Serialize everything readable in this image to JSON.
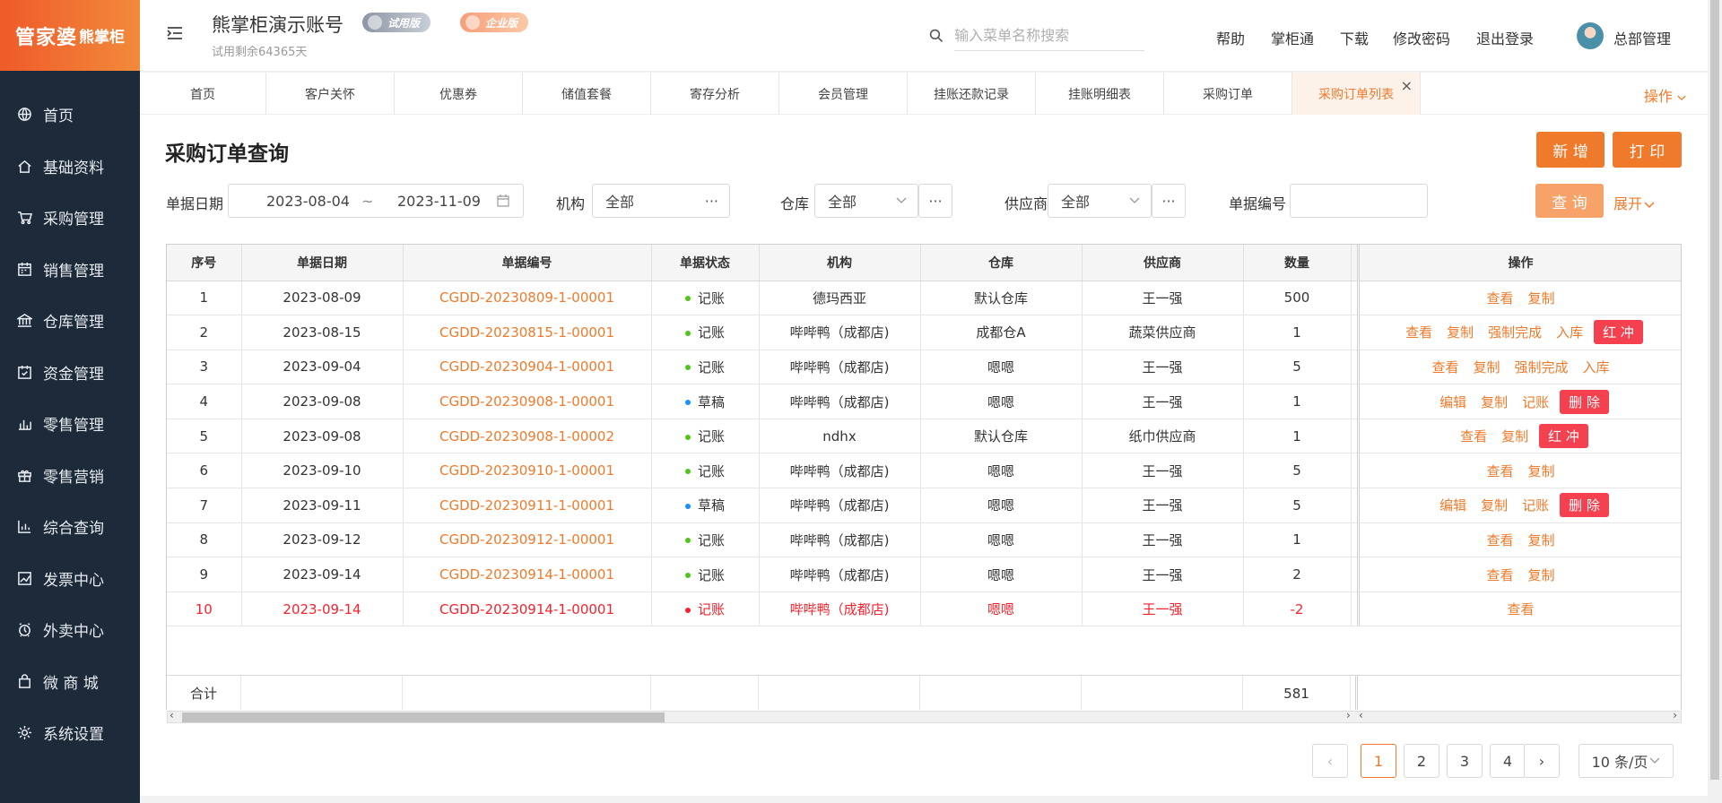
{
  "logo": {
    "part1": "管家婆",
    "part2": "熊掌柜"
  },
  "sidebar": {
    "items": [
      {
        "label": "首页",
        "icon": "globe-icon"
      },
      {
        "label": "基础资料",
        "icon": "home-icon"
      },
      {
        "label": "采购管理",
        "icon": "cart-icon"
      },
      {
        "label": "销售管理",
        "icon": "calendar-icon"
      },
      {
        "label": "仓库管理",
        "icon": "bank-icon"
      },
      {
        "label": "资金管理",
        "icon": "calendar-check-icon"
      },
      {
        "label": "零售管理",
        "icon": "bar-chart-icon"
      },
      {
        "label": "零售营销",
        "icon": "gift-icon"
      },
      {
        "label": "综合查询",
        "icon": "chart-icon"
      },
      {
        "label": "发票中心",
        "icon": "line-chart-icon"
      },
      {
        "label": "外卖中心",
        "icon": "alarm-icon"
      },
      {
        "label": "微 商 城",
        "icon": "bag-icon"
      },
      {
        "label": "系统设置",
        "icon": "gear-icon"
      }
    ]
  },
  "header": {
    "account_title": "熊掌柜演示账号",
    "trial_note": "试用剩余64365天",
    "badge_trial": "试用版",
    "badge_enterprise": "企业版",
    "search_placeholder": "输入菜单名称搜索",
    "links": {
      "help": "帮助",
      "app": "掌柜通",
      "download": "下载",
      "change_password": "修改密码",
      "logout": "退出登录"
    },
    "user": "总部管理"
  },
  "tabs": {
    "items": [
      "首页",
      "客户关怀",
      "优惠券",
      "储值套餐",
      "寄存分析",
      "会员管理",
      "挂账还款记录",
      "挂账明细表",
      "采购订单",
      "采购订单列表"
    ],
    "ops": "操作"
  },
  "page": {
    "title": "采购订单查询",
    "buttons": {
      "new": "新 增",
      "print": "打 印",
      "query": "查 询",
      "expand": "展开"
    },
    "filters": {
      "date_label": "单据日期",
      "date_from": "2023-08-04",
      "date_sep": "~",
      "date_to": "2023-11-09",
      "org_label": "机构",
      "org_value": "全部",
      "warehouse_label": "仓库",
      "warehouse_value": "全部",
      "supplier_label": "供应商",
      "supplier_value": "全部",
      "code_label": "单据编号",
      "code_value": ""
    }
  },
  "table": {
    "headers": [
      "序号",
      "单据日期",
      "单据编号",
      "单据状态",
      "机构",
      "仓库",
      "供应商",
      "数量",
      "操作"
    ],
    "rows": [
      {
        "no": "1",
        "date": "2023-08-09",
        "code": "CGDD-20230809-1-00001",
        "status": "记账",
        "status_color": "#52c41a",
        "org": "德玛西亚",
        "wh": "默认仓库",
        "sup": "王一强",
        "qty": "500",
        "ops": [
          "查看",
          "复制"
        ],
        "danger": ""
      },
      {
        "no": "2",
        "date": "2023-08-15",
        "code": "CGDD-20230815-1-00001",
        "status": "记账",
        "status_color": "#52c41a",
        "org": "哔哔鸭（成都店)",
        "wh": "成都仓A",
        "sup": "蔬菜供应商",
        "qty": "1",
        "ops": [
          "查看",
          "复制",
          "强制完成",
          "入库"
        ],
        "danger": "红 冲"
      },
      {
        "no": "3",
        "date": "2023-09-04",
        "code": "CGDD-20230904-1-00001",
        "status": "记账",
        "status_color": "#52c41a",
        "org": "哔哔鸭（成都店)",
        "wh": "嗯嗯",
        "sup": "王一强",
        "qty": "5",
        "ops": [
          "查看",
          "复制",
          "强制完成",
          "入库"
        ],
        "danger": ""
      },
      {
        "no": "4",
        "date": "2023-09-08",
        "code": "CGDD-20230908-1-00001",
        "status": "草稿",
        "status_color": "#1890ff",
        "org": "哔哔鸭（成都店)",
        "wh": "嗯嗯",
        "sup": "王一强",
        "qty": "1",
        "ops": [
          "编辑",
          "复制",
          "记账"
        ],
        "danger": "删 除"
      },
      {
        "no": "5",
        "date": "2023-09-08",
        "code": "CGDD-20230908-1-00002",
        "status": "记账",
        "status_color": "#52c41a",
        "org": "ndhx",
        "wh": "默认仓库",
        "sup": "纸巾供应商",
        "qty": "1",
        "ops": [
          "查看",
          "复制"
        ],
        "danger": "红 冲"
      },
      {
        "no": "6",
        "date": "2023-09-10",
        "code": "CGDD-20230910-1-00001",
        "status": "记账",
        "status_color": "#52c41a",
        "org": "哔哔鸭（成都店)",
        "wh": "嗯嗯",
        "sup": "王一强",
        "qty": "5",
        "ops": [
          "查看",
          "复制"
        ],
        "danger": ""
      },
      {
        "no": "7",
        "date": "2023-09-11",
        "code": "CGDD-20230911-1-00001",
        "status": "草稿",
        "status_color": "#1890ff",
        "org": "哔哔鸭（成都店)",
        "wh": "嗯嗯",
        "sup": "王一强",
        "qty": "5",
        "ops": [
          "编辑",
          "复制",
          "记账"
        ],
        "danger": "删 除"
      },
      {
        "no": "8",
        "date": "2023-09-12",
        "code": "CGDD-20230912-1-00001",
        "status": "记账",
        "status_color": "#52c41a",
        "org": "哔哔鸭（成都店)",
        "wh": "嗯嗯",
        "sup": "王一强",
        "qty": "1",
        "ops": [
          "查看",
          "复制"
        ],
        "danger": ""
      },
      {
        "no": "9",
        "date": "2023-09-14",
        "code": "CGDD-20230914-1-00001",
        "status": "记账",
        "status_color": "#52c41a",
        "org": "哔哔鸭（成都店)",
        "wh": "嗯嗯",
        "sup": "王一强",
        "qty": "2",
        "ops": [
          "查看",
          "复制"
        ],
        "danger": ""
      },
      {
        "no": "10",
        "date": "2023-09-14",
        "code": "CGDD-20230914-1-00001",
        "status": "记账",
        "status_color": "#f5222d",
        "org": "哔哔鸭（成都店)",
        "wh": "嗯嗯",
        "sup": "王一强",
        "qty": "-2",
        "ops": [
          "查看"
        ],
        "danger": "",
        "negative": true
      }
    ],
    "totals_label": "合计",
    "totals_qty": "581"
  },
  "pagination": {
    "pages": [
      "1",
      "2",
      "3",
      "4"
    ],
    "current": "1",
    "page_size": "10 条/页"
  },
  "colors": {
    "accent": "#f07a2b",
    "sidebar_bg": "#1d2a39",
    "danger": "#f5414f"
  }
}
